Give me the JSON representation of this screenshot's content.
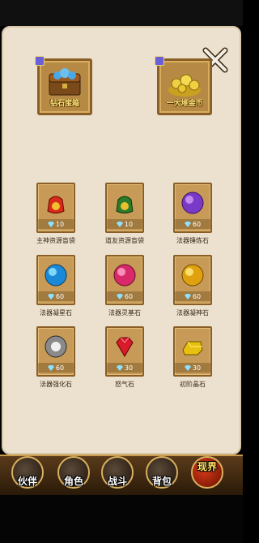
{
  "chests": [
    {
      "label": "钻石宝箱"
    },
    {
      "label": "一大堆金币"
    }
  ],
  "items": [
    {
      "name": "主神资源盲袋",
      "price": "10",
      "orb": "red-bag"
    },
    {
      "name": "道友资源盲袋",
      "price": "10",
      "orb": "green-bag"
    },
    {
      "name": "法器锤炼石",
      "price": "60",
      "orb": "purple-orb"
    },
    {
      "name": "法器凝星石",
      "price": "60",
      "orb": "blue-orb"
    },
    {
      "name": "法器灵基石",
      "price": "60",
      "orb": "pink-orb"
    },
    {
      "name": "法器凝神石",
      "price": "60",
      "orb": "gold-orb"
    },
    {
      "name": "法器强化石",
      "price": "60",
      "orb": "silver-orb"
    },
    {
      "name": "怒气石",
      "price": "30",
      "orb": "ruby-gem"
    },
    {
      "name": "初阶晶石",
      "price": "30",
      "orb": "gold-ingot"
    }
  ],
  "nav": {
    "partner": "伙伴",
    "role": "角色",
    "battle": "战斗",
    "bag": "背包",
    "other": "现界"
  },
  "colors": {
    "panel": "#ece1ce",
    "card": "#c79b57",
    "label_text": "#3a2a18"
  }
}
